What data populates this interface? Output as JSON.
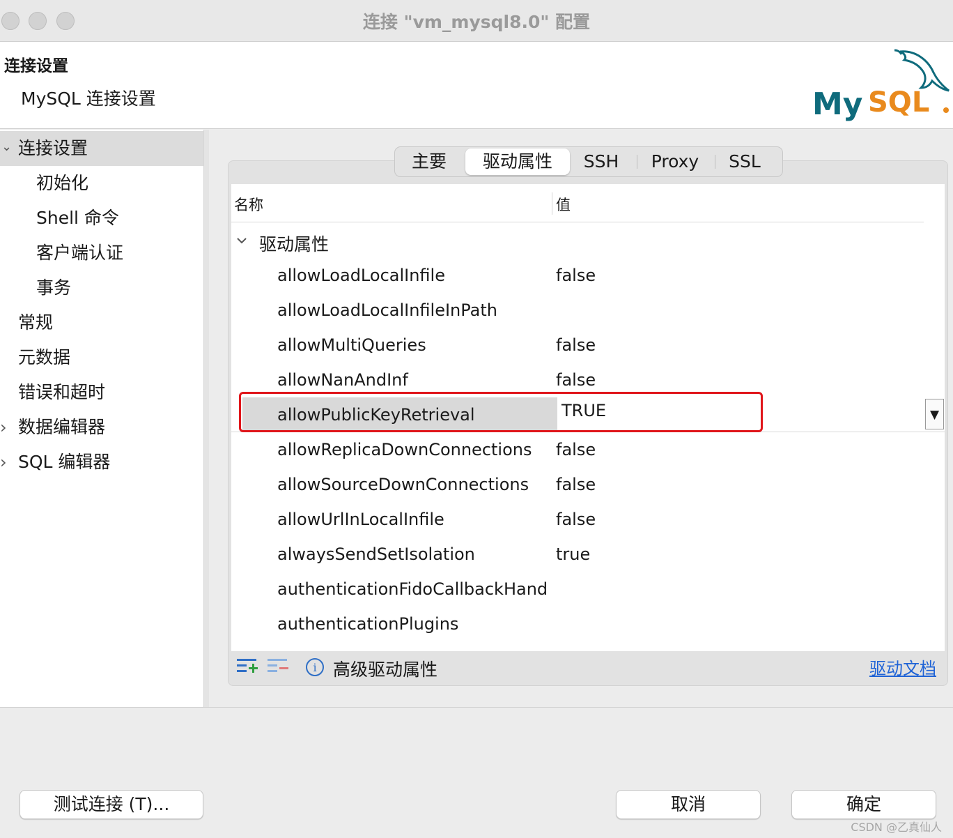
{
  "window": {
    "title": "连接 \"vm_mysql8.0\" 配置"
  },
  "header": {
    "title": "连接设置",
    "subtitle": "MySQL 连接设置",
    "logo_text": "MySQL"
  },
  "sidebar": {
    "items": [
      {
        "label": "连接设置",
        "chevron": "⌄"
      },
      {
        "label": "初始化"
      },
      {
        "label": "Shell 命令"
      },
      {
        "label": "客户端认证"
      },
      {
        "label": "事务"
      },
      {
        "label": "常规"
      },
      {
        "label": "元数据"
      },
      {
        "label": "错误和超时"
      },
      {
        "label": "数据编辑器",
        "chevron": "›"
      },
      {
        "label": "SQL 编辑器",
        "chevron": "›"
      }
    ]
  },
  "tabs": [
    {
      "label": "主要"
    },
    {
      "label": "驱动属性"
    },
    {
      "label": "SSH"
    },
    {
      "label": "Proxy"
    },
    {
      "label": "SSL"
    }
  ],
  "table": {
    "col_name": "名称",
    "col_value": "值",
    "group": "驱动属性",
    "rows": [
      {
        "name": "allowLoadLocalInfile",
        "value": "false"
      },
      {
        "name": "allowLoadLocalInfileInPath",
        "value": ""
      },
      {
        "name": "allowMultiQueries",
        "value": "false"
      },
      {
        "name": "allowNanAndInf",
        "value": "false"
      },
      {
        "name": "allowPublicKeyRetrieval",
        "value": "TRUE"
      },
      {
        "name": "allowReplicaDownConnections",
        "value": "false"
      },
      {
        "name": "allowSourceDownConnections",
        "value": "false"
      },
      {
        "name": "allowUrlInLocalInfile",
        "value": "false"
      },
      {
        "name": "alwaysSendSetIsolation",
        "value": "true"
      },
      {
        "name": "authenticationFidoCallbackHand",
        "value": ""
      },
      {
        "name": "authenticationPlugins",
        "value": ""
      }
    ],
    "dropdown_arrow": "▼"
  },
  "toolbar": {
    "advanced_label": "高级驱动属性",
    "doc_link": "驱动文档",
    "info_glyph": "i"
  },
  "buttons": {
    "test": "测试连接 (T)...",
    "cancel": "取消",
    "ok": "确定"
  },
  "watermark": "CSDN @乙真仙人"
}
